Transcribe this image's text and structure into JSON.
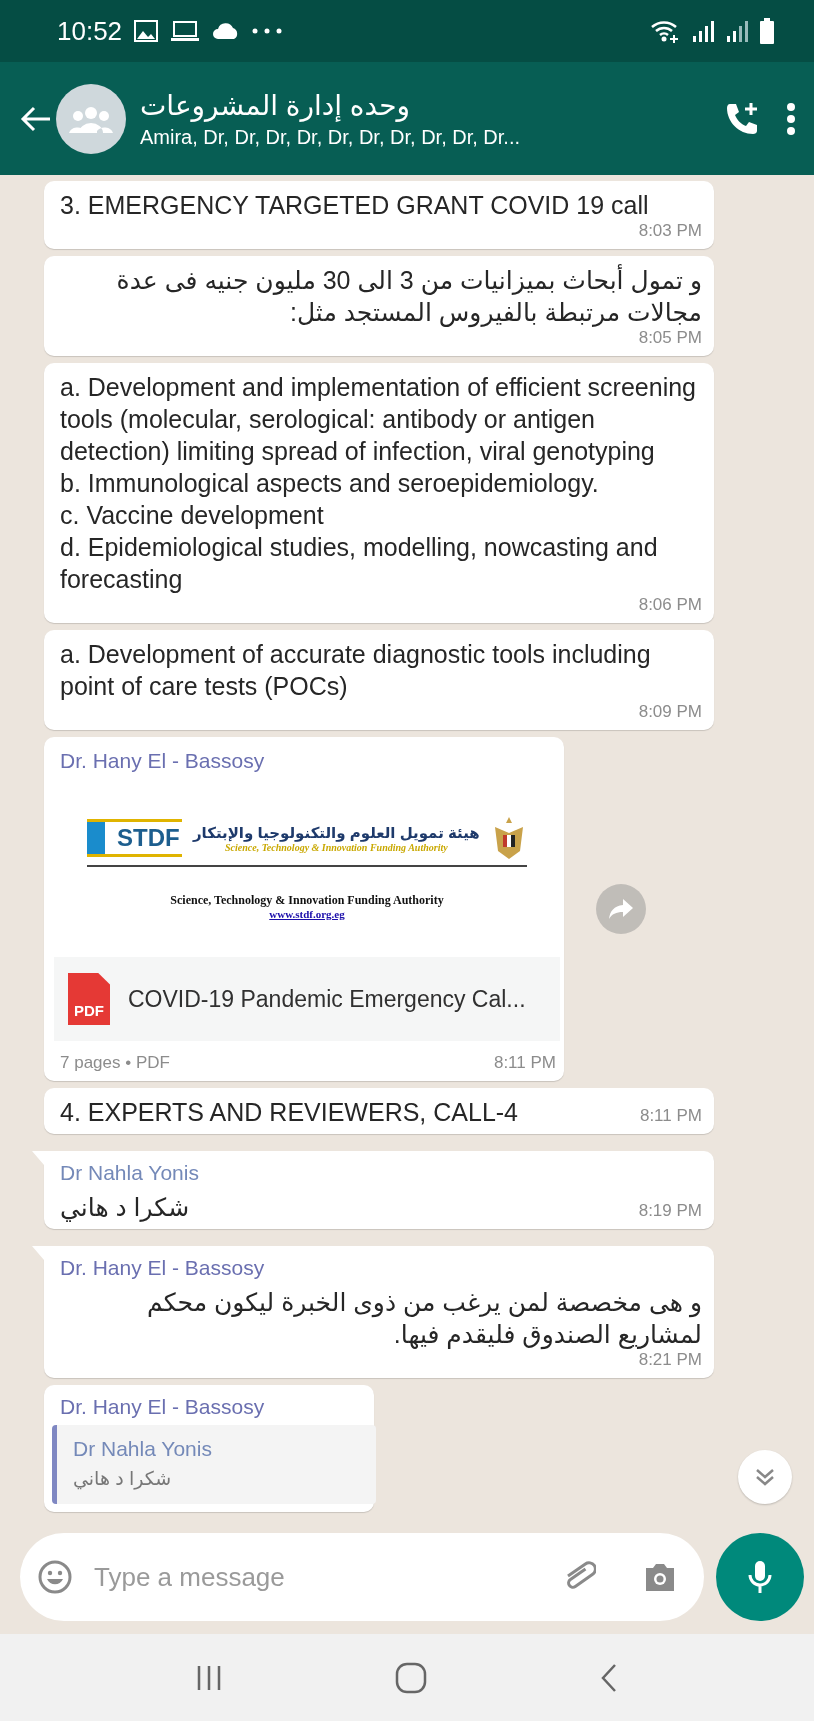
{
  "status_bar": {
    "time": "10:52"
  },
  "header": {
    "title": "وحده إدارة المشروعات",
    "subtitle": "Amira, Dr, Dr, Dr, Dr, Dr, Dr, Dr, Dr, Dr, Dr..."
  },
  "messages": [
    {
      "kind": "text",
      "tail": false,
      "lines": [
        "3. EMERGENCY TARGETED GRANT COVID 19 call"
      ],
      "time": "8:03 PM"
    },
    {
      "kind": "arabic_text",
      "tail": false,
      "lines": [
        "و تمول أبحاث بميزانيات من 3 الى 30 مليون جنيه فى عدة مجالات مرتبطة بالفيروس المستجد مثل:"
      ],
      "time": "8:05 PM"
    },
    {
      "kind": "text",
      "tail": false,
      "lines": [
        "a. Development and implementation of efficient screening tools (molecular, serological: antibody or antigen detection) limiting spread of infection, viral genotyping",
        "b. Immunological aspects and seroepidemiology.",
        "c. Vaccine development",
        "d. Epidemiological studies, modelling, nowcasting and forecasting"
      ],
      "time": "8:06 PM"
    },
    {
      "kind": "text",
      "tail": false,
      "lines": [
        "a. Development of accurate diagnostic tools including point of care tests (POCs)"
      ],
      "time": "8:09 PM"
    },
    {
      "kind": "document",
      "sender": "Dr. Hany El - Bassosy",
      "color": "#6a6fb0",
      "preview": {
        "logo": "STDF",
        "arabic_name": "هيئة تمويل العلوم والتكنولوجيا والإبتكار",
        "english_name": "Science, Technology & Innovation Funding Authority",
        "heading": "Science, Technology & Innovation Funding Authority",
        "link": "www.stdf.org.eg"
      },
      "file_badge": "PDF",
      "file_name": "COVID-19 Pandemic Emergency Cal...",
      "meta": "7 pages • PDF",
      "time": "8:11 PM"
    },
    {
      "kind": "text",
      "tail": false,
      "lines": [
        "4. EXPERTS AND REVIEWERS, CALL-4"
      ],
      "time": "8:11 PM"
    },
    {
      "kind": "arabic_text",
      "tail": true,
      "sender": "Dr Nahla Yonis",
      "color": "#7489b8",
      "lines": [
        "شكرا د هاني"
      ],
      "time": "8:19 PM"
    },
    {
      "kind": "arabic_text",
      "tail": true,
      "sender": "Dr. Hany El - Bassosy",
      "color": "#6a6fb0",
      "lines": [
        "و هى مخصصة لمن يرغب من ذوى الخبرة ليكون محكم لمشاريع الصندوق فليقدم فيها."
      ],
      "time": "8:21 PM"
    },
    {
      "kind": "reply",
      "sender": "Dr. Hany El - Bassosy",
      "color": "#6a6fb0",
      "quote": {
        "sender": "Dr Nahla Yonis",
        "text": "شكرا د هاني"
      }
    }
  ],
  "composer": {
    "placeholder": "Type a message"
  }
}
